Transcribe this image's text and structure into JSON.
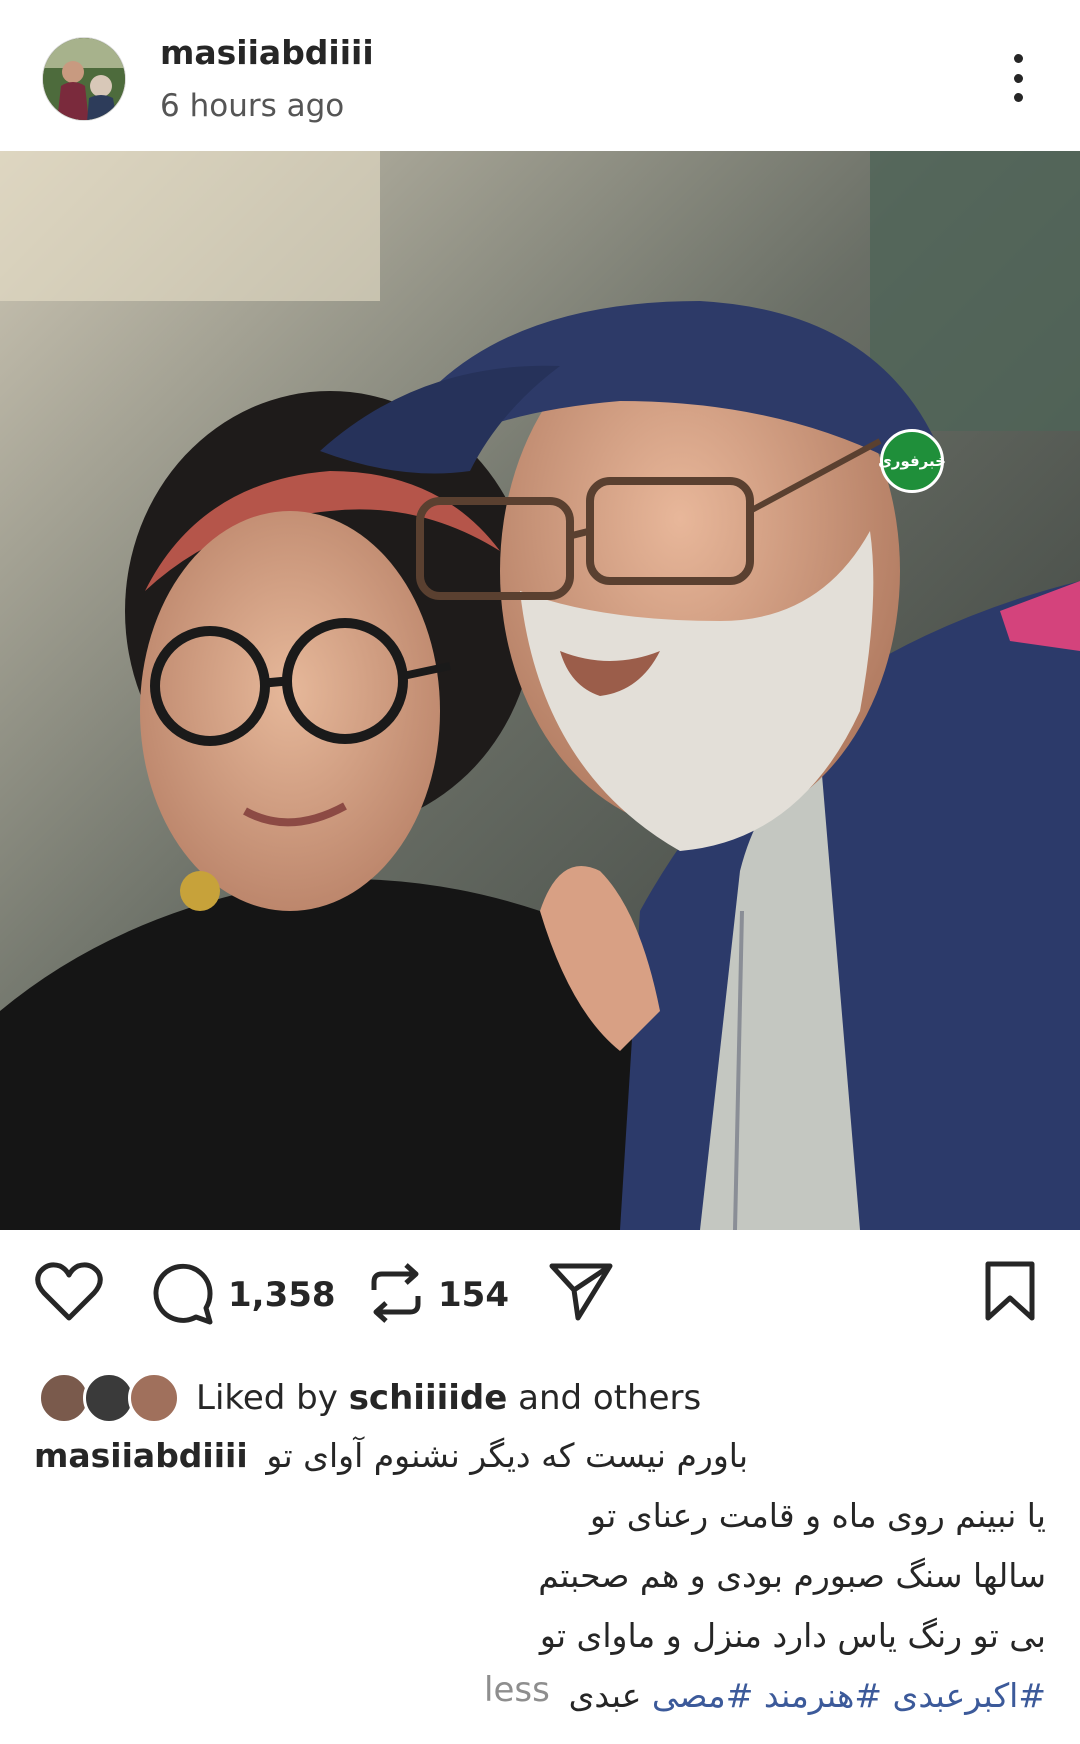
{
  "header": {
    "username": "masiiabdiiii",
    "timestamp": "6 hours ago",
    "more_icon": "more-vertical-icon"
  },
  "photo": {
    "watermark_text": "خبرفوری"
  },
  "actions": {
    "like_icon": "heart-icon",
    "comment_icon": "comment-icon",
    "comment_count": "1,358",
    "repost_icon": "repost-icon",
    "repost_count": "154",
    "share_icon": "send-icon",
    "save_icon": "bookmark-icon"
  },
  "likes": {
    "prefix": "Liked by ",
    "user": "schiiiide",
    "suffix": " and others"
  },
  "caption": {
    "username": "masiiabdiiii",
    "lines": [
      "باورم نیست که دیگر نشنوم آوای تو",
      "یا نبینم روی ماه و قامت رعنای تو",
      "سالها سنگ صبورم بودی و هم صحبتم",
      "بی تو رنگ یاس دارد منزل و ماوای تو"
    ],
    "hashtags": "#اکبرعبدی #هنرمند #مصی",
    "tail": "عبدی",
    "less_label": "less"
  },
  "colors": {
    "text": "#262626",
    "secondary": "#8e8e8e",
    "hashtag": "#3c5a9a",
    "watermark_green": "#1f8f3a"
  }
}
